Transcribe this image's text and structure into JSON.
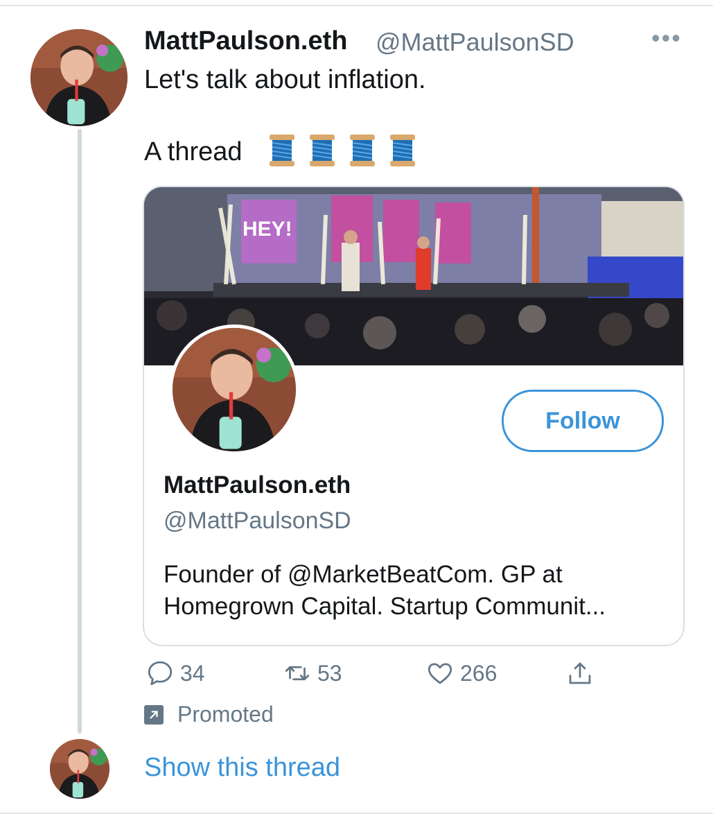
{
  "tweet": {
    "display_name": "MattPaulson.eth",
    "handle": "@MattPaulsonSD",
    "more_icon": "more-horizontal-icon",
    "text_line1": "Let's talk about inflation.",
    "text_line2": "A thread",
    "emoji": [
      "spool-of-thread",
      "spool-of-thread",
      "spool-of-thread",
      "spool-of-thread"
    ]
  },
  "card": {
    "banner_text": "HEY!",
    "follow_label": "Follow",
    "name": "MattPaulson.eth",
    "handle": "@MattPaulsonSD",
    "bio_line1": "Founder of @MarketBeatCom. GP at",
    "bio_line2": "Homegrown Capital. Startup Communit..."
  },
  "actions": {
    "reply": {
      "icon": "reply-icon",
      "count": "34"
    },
    "retweet": {
      "icon": "retweet-icon",
      "count": "53"
    },
    "like": {
      "icon": "heart-icon",
      "count": "266"
    },
    "share": {
      "icon": "share-icon"
    }
  },
  "promoted_label": "Promoted",
  "show_thread_label": "Show this thread",
  "colors": {
    "link_blue": "#3b94d9",
    "secondary_text": "#657786",
    "thread_line": "#cfd9de",
    "border": "#d8e0e6"
  }
}
